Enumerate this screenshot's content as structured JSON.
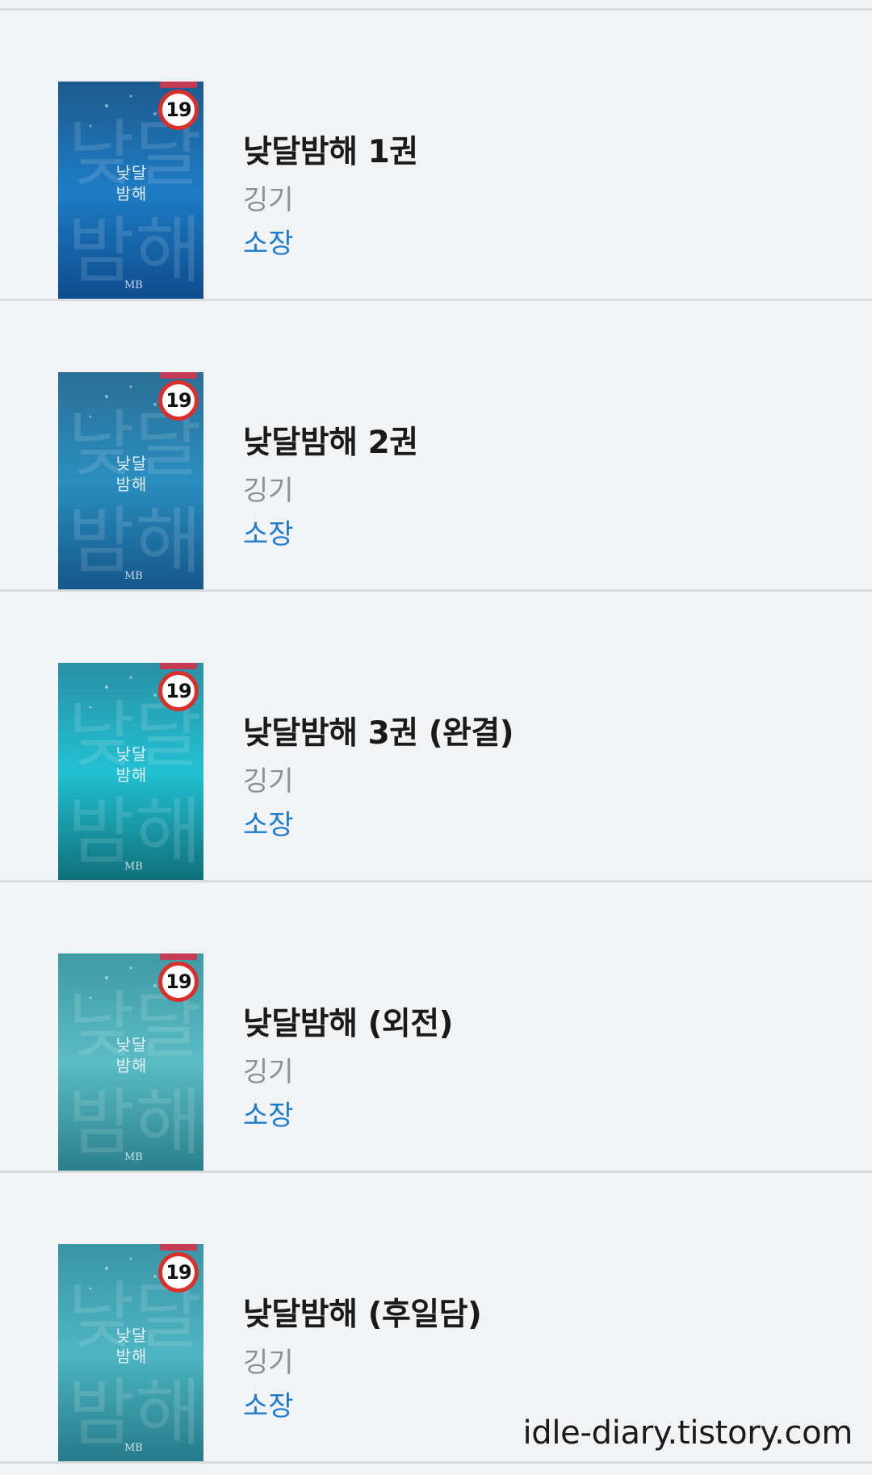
{
  "books": [
    {
      "title": "낮달밤해 1권",
      "author": "깅기",
      "status": "소장",
      "age_rating": "19",
      "cover_text": "낮달 밤해",
      "cover_publisher": "MB",
      "cover_colors": [
        "#1d5a8e",
        "#1e7cc4",
        "#0e4c8e"
      ]
    },
    {
      "title": "낮달밤해 2권",
      "author": "깅기",
      "status": "소장",
      "age_rating": "19",
      "cover_text": "낮달 밤해",
      "cover_publisher": "MB",
      "cover_colors": [
        "#2a6f96",
        "#2a8ec0",
        "#15578a"
      ]
    },
    {
      "title": "낮달밤해 3권 (완결)",
      "author": "깅기",
      "status": "소장",
      "age_rating": "19",
      "cover_text": "낮달 밤해",
      "cover_publisher": "MB",
      "cover_colors": [
        "#2a90a5",
        "#22c0d2",
        "#0f6f7a"
      ]
    },
    {
      "title": "낮달밤해 (외전)",
      "author": "깅기",
      "status": "소장",
      "age_rating": "19",
      "cover_text": "낮달 밤해",
      "cover_publisher": "MB",
      "cover_colors": [
        "#3f9aa6",
        "#5abcc4",
        "#2a7f8c"
      ]
    },
    {
      "title": "낮달밤해 (후일담)",
      "author": "깅기",
      "status": "소장",
      "age_rating": "19",
      "cover_text": "낮달 밤해",
      "cover_publisher": "MB",
      "cover_colors": [
        "#3a95a6",
        "#4eb5c2",
        "#257a88"
      ]
    }
  ],
  "watermark": "idle-diary.tistory.com"
}
